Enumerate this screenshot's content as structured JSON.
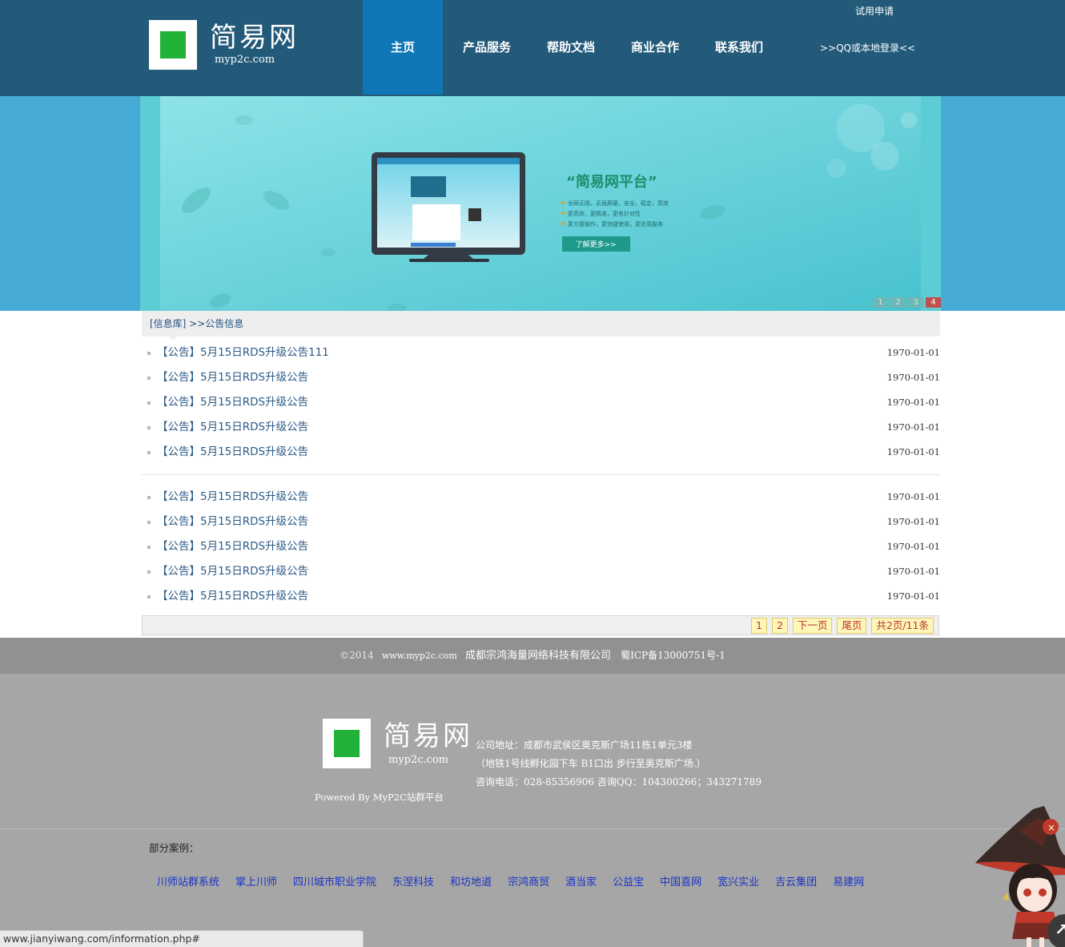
{
  "header": {
    "logo_name": "简易网",
    "logo_url": "myp2c.com",
    "trial": "试用申请",
    "login": ">>QQ或本地登录<<",
    "nav": [
      {
        "label": "主页"
      },
      {
        "label": "产品服务"
      },
      {
        "label": "帮助文档"
      },
      {
        "label": "商业合作"
      },
      {
        "label": "联系我们"
      }
    ]
  },
  "banner": {
    "heading": "“简易网平台”",
    "bullets": [
      "全网无阻，无插屏蔽，安全，稳定，高效",
      "更高效，更精准，更有针对性",
      "更方便操作，更快捷使用，更优质服务"
    ],
    "button": "了解更多>>",
    "pages": [
      "1",
      "2",
      "3",
      "4"
    ]
  },
  "breadcrumb": {
    "text": "[信息库] >>公告信息"
  },
  "list_a": [
    {
      "title": "【公告】5月15日RDS升级公告111",
      "date": "1970-01-01"
    },
    {
      "title": "【公告】5月15日RDS升级公告",
      "date": "1970-01-01"
    },
    {
      "title": "【公告】5月15日RDS升级公告",
      "date": "1970-01-01"
    },
    {
      "title": "【公告】5月15日RDS升级公告",
      "date": "1970-01-01"
    },
    {
      "title": "【公告】5月15日RDS升级公告",
      "date": "1970-01-01"
    }
  ],
  "list_b": [
    {
      "title": "【公告】5月15日RDS升级公告",
      "date": "1970-01-01"
    },
    {
      "title": "【公告】5月15日RDS升级公告",
      "date": "1970-01-01"
    },
    {
      "title": "【公告】5月15日RDS升级公告",
      "date": "1970-01-01"
    },
    {
      "title": "【公告】5月15日RDS升级公告",
      "date": "1970-01-01"
    },
    {
      "title": "【公告】5月15日RDS升级公告",
      "date": "1970-01-01"
    }
  ],
  "pager": {
    "p1": "1",
    "p2": "2",
    "next": "下一页",
    "last": "尾页",
    "total": "共2页/11条"
  },
  "footer": {
    "year": "©2014",
    "site": "www.myp2c.com",
    "company": "成都宗鸿海量网络科技有限公司",
    "icp": "蜀ICP备13000751号-1",
    "logo_name": "简易网",
    "logo_url": "myp2c.com",
    "address": "公司地址：成都市武侯区奥克斯广场11栋1单元3楼",
    "route": "（地铁1号线孵化园下车 B1口出 步行至奥克斯广场.）",
    "phone": "咨询电话：028-85356906 咨询QQ：104300266；343271789",
    "powered": "Powered By MyP2C站群平台"
  },
  "cases": {
    "title": "部分案例：",
    "items": [
      "川师站群系统",
      "掌上川师",
      "四川城市职业学院",
      "东涅科技",
      "和坊地道",
      "宗鸿商贸",
      "酒当家",
      "公益宝",
      "中国喜网",
      "宽兴实业",
      "吉云集团",
      "易建网"
    ]
  },
  "status_url": "www.jianyiwang.com/information.php#",
  "colors": {
    "header_bg": "#235a79",
    "nav_active": "#1077b6",
    "banner_bg": "#46aad6",
    "logo_green": "#22b23a",
    "link": "#2c5b87",
    "pager_bg": "#fff7b8",
    "pager_text": "#bb3333",
    "footer_dark": "#919191",
    "footer_light": "#a6a6a6",
    "case_link": "#1a33c8"
  },
  "icons": {
    "logo": "logo-icon",
    "scroll_top": "arrow-up-icon",
    "mascot": "mascot-icon"
  }
}
